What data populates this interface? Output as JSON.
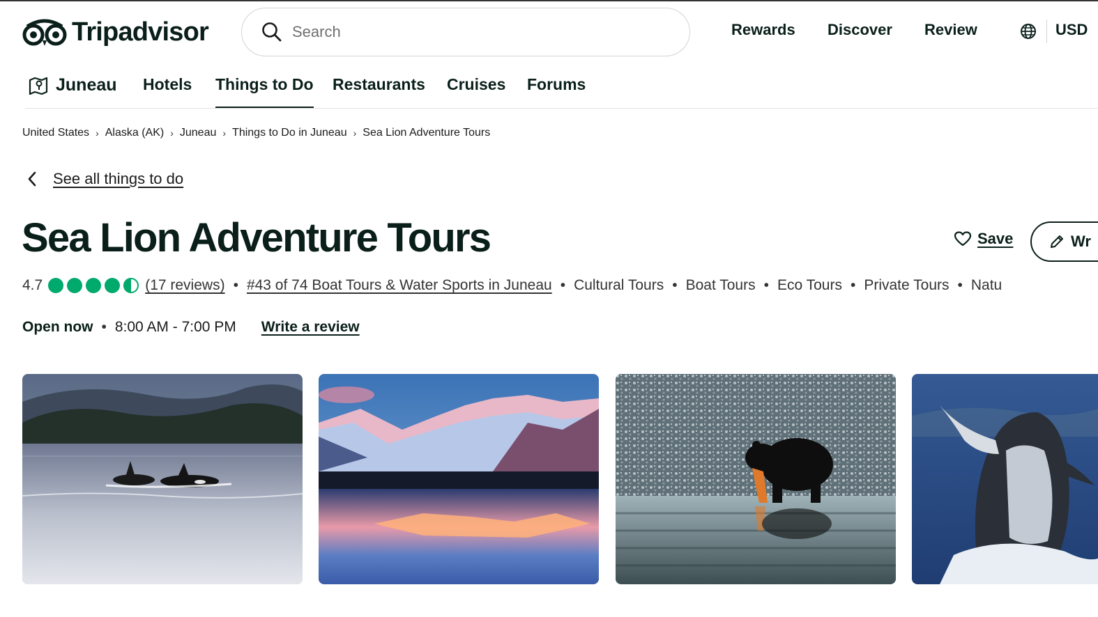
{
  "header": {
    "logo_text": "Tripadvisor",
    "search_placeholder": "Search",
    "nav": {
      "rewards": "Rewards",
      "discover": "Discover",
      "review": "Review",
      "currency": "USD"
    }
  },
  "subnav": {
    "location": "Juneau",
    "items": [
      "Hotels",
      "Things to Do",
      "Restaurants",
      "Cruises",
      "Forums"
    ],
    "active": "Things to Do"
  },
  "breadcrumb": [
    "United States",
    "Alaska (AK)",
    "Juneau",
    "Things to Do in Juneau",
    "Sea Lion Adventure Tours"
  ],
  "back_link": "See all things to do",
  "listing": {
    "title": "Sea Lion Adventure Tours",
    "save_label": "Save",
    "write_button_label": "Wr",
    "rating": "4.7",
    "rating_bubbles": 4.5,
    "reviews_link": "(17 reviews)",
    "ranking_link": "#43 of 74 Boat Tours & Water Sports in Juneau",
    "categories": [
      "Cultural Tours",
      "Boat Tours",
      "Eco Tours",
      "Private Tours",
      "Natu"
    ],
    "open_status": "Open now",
    "hours": "8:00 AM - 7:00 PM",
    "write_review_link": "Write a review"
  },
  "photos": [
    {
      "name": "orca-whales-photo"
    },
    {
      "name": "mendenhall-glacier-sunset-photo"
    },
    {
      "name": "black-bear-salmon-photo"
    },
    {
      "name": "humpback-whale-breach-photo"
    }
  ],
  "colors": {
    "brand_green": "#0a1f1a",
    "bubble_green": "#00aa6c",
    "border": "#d3d3d3"
  }
}
